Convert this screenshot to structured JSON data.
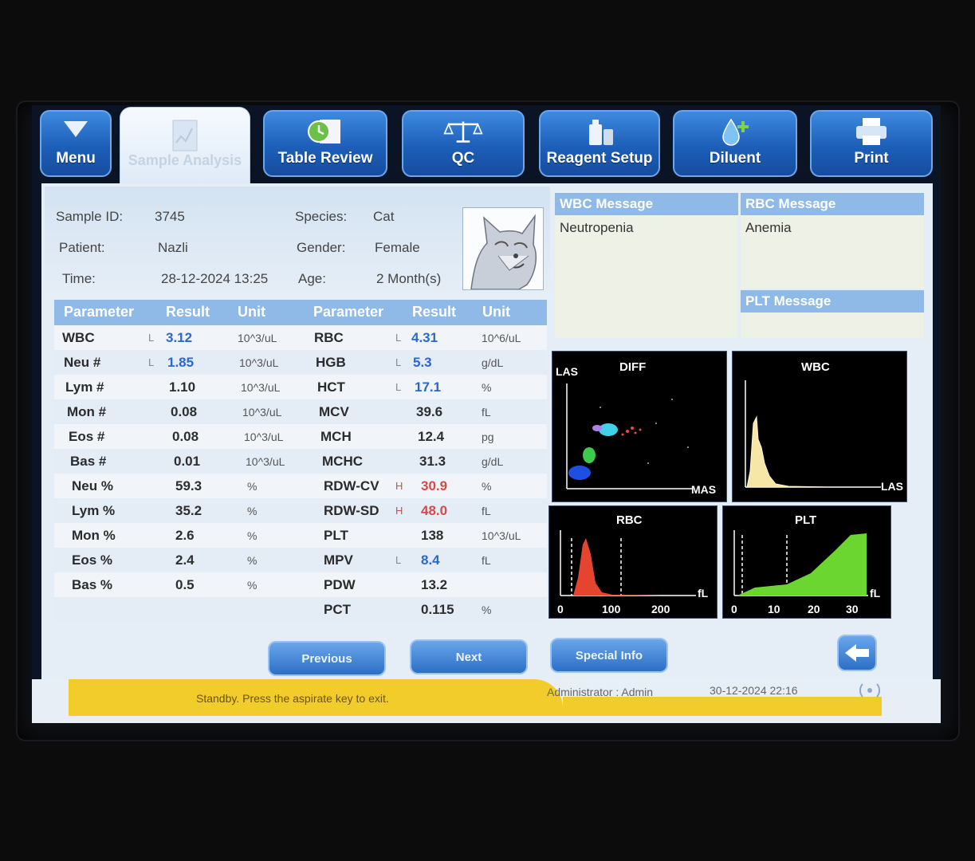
{
  "nav": {
    "menu": "Menu",
    "sample_analysis": "Sample Analysis",
    "table_review": "Table Review",
    "qc": "QC",
    "reagent_setup": "Reagent Setup",
    "diluent": "Diluent",
    "print": "Print"
  },
  "patient": {
    "sample_id_label": "Sample ID:",
    "sample_id": "3745",
    "patient_label": "Patient:",
    "patient": "Nazli",
    "time_label": "Time:",
    "time": "28-12-2024 13:25",
    "species_label": "Species:",
    "species": "Cat",
    "gender_label": "Gender:",
    "gender": "Female",
    "age_label": "Age:",
    "age": "2 Month(s)"
  },
  "table_headers": {
    "parameter": "Parameter",
    "result": "Result",
    "unit": "Unit"
  },
  "left_results": [
    {
      "name": "WBC",
      "flag": "L",
      "value": "3.12",
      "unit": "10^3/uL",
      "status": "low"
    },
    {
      "name": "Neu #",
      "flag": "L",
      "value": "1.85",
      "unit": "10^3/uL",
      "status": "low"
    },
    {
      "name": "Lym #",
      "flag": "",
      "value": "1.10",
      "unit": "10^3/uL",
      "status": "normal"
    },
    {
      "name": "Mon #",
      "flag": "",
      "value": "0.08",
      "unit": "10^3/uL",
      "status": "normal"
    },
    {
      "name": "Eos #",
      "flag": "",
      "value": "0.08",
      "unit": "10^3/uL",
      "status": "normal"
    },
    {
      "name": "Bas #",
      "flag": "",
      "value": "0.01",
      "unit": "10^3/uL",
      "status": "normal"
    },
    {
      "name": "Neu %",
      "flag": "",
      "value": "59.3",
      "unit": "%",
      "status": "normal"
    },
    {
      "name": "Lym %",
      "flag": "",
      "value": "35.2",
      "unit": "%",
      "status": "normal"
    },
    {
      "name": "Mon %",
      "flag": "",
      "value": "2.6",
      "unit": "%",
      "status": "normal"
    },
    {
      "name": "Eos %",
      "flag": "",
      "value": "2.4",
      "unit": "%",
      "status": "normal"
    },
    {
      "name": "Bas %",
      "flag": "",
      "value": "0.5",
      "unit": "%",
      "status": "normal"
    }
  ],
  "right_results": [
    {
      "name": "RBC",
      "flag": "L",
      "value": "4.31",
      "unit": "10^6/uL",
      "status": "low"
    },
    {
      "name": "HGB",
      "flag": "L",
      "value": "5.3",
      "unit": "g/dL",
      "status": "low"
    },
    {
      "name": "HCT",
      "flag": "L",
      "value": "17.1",
      "unit": "%",
      "status": "low"
    },
    {
      "name": "MCV",
      "flag": "",
      "value": "39.6",
      "unit": "fL",
      "status": "normal"
    },
    {
      "name": "MCH",
      "flag": "",
      "value": "12.4",
      "unit": "pg",
      "status": "normal"
    },
    {
      "name": "MCHC",
      "flag": "",
      "value": "31.3",
      "unit": "g/dL",
      "status": "normal"
    },
    {
      "name": "RDW-CV",
      "flag": "H",
      "value": "30.9",
      "unit": "%",
      "status": "high"
    },
    {
      "name": "RDW-SD",
      "flag": "H",
      "value": "48.0",
      "unit": "fL",
      "status": "high"
    },
    {
      "name": "PLT",
      "flag": "",
      "value": "138",
      "unit": "10^3/uL",
      "status": "normal"
    },
    {
      "name": "MPV",
      "flag": "L",
      "value": "8.4",
      "unit": "fL",
      "status": "low"
    },
    {
      "name": "PDW",
      "flag": "",
      "value": "13.2",
      "unit": "",
      "status": "normal"
    },
    {
      "name": "PCT",
      "flag": "",
      "value": "0.115",
      "unit": "%",
      "status": "normal"
    }
  ],
  "messages": {
    "wbc_title": "WBC Message",
    "wbc_text": "Neutropenia",
    "rbc_title": "RBC Message",
    "rbc_text": "Anemia",
    "plt_title": "PLT Message",
    "plt_text": ""
  },
  "graphs": {
    "diff": {
      "title": "DIFF",
      "y_label": "LAS",
      "x_label": "MAS"
    },
    "wbc": {
      "title": "WBC",
      "x_label": "LAS"
    },
    "rbc": {
      "title": "RBC",
      "unit": "fL",
      "ticks": [
        "0",
        "100",
        "200"
      ]
    },
    "plt": {
      "title": "PLT",
      "unit": "fL",
      "ticks": [
        "0",
        "10",
        "20",
        "30"
      ]
    }
  },
  "footer": {
    "previous": "Previous",
    "next": "Next",
    "special_info": "Special Info",
    "status": "Standby. Press the aspirate key to exit.",
    "user": "Administrator : Admin",
    "datetime": "30-12-2024 22:16"
  },
  "colors": {
    "nav_blue": "#1d5fb9",
    "header_blue": "#8fb9e6",
    "low_flag": "#2a67d0",
    "high_flag": "#d24a4a",
    "status_yellow": "#f2cc2a"
  }
}
